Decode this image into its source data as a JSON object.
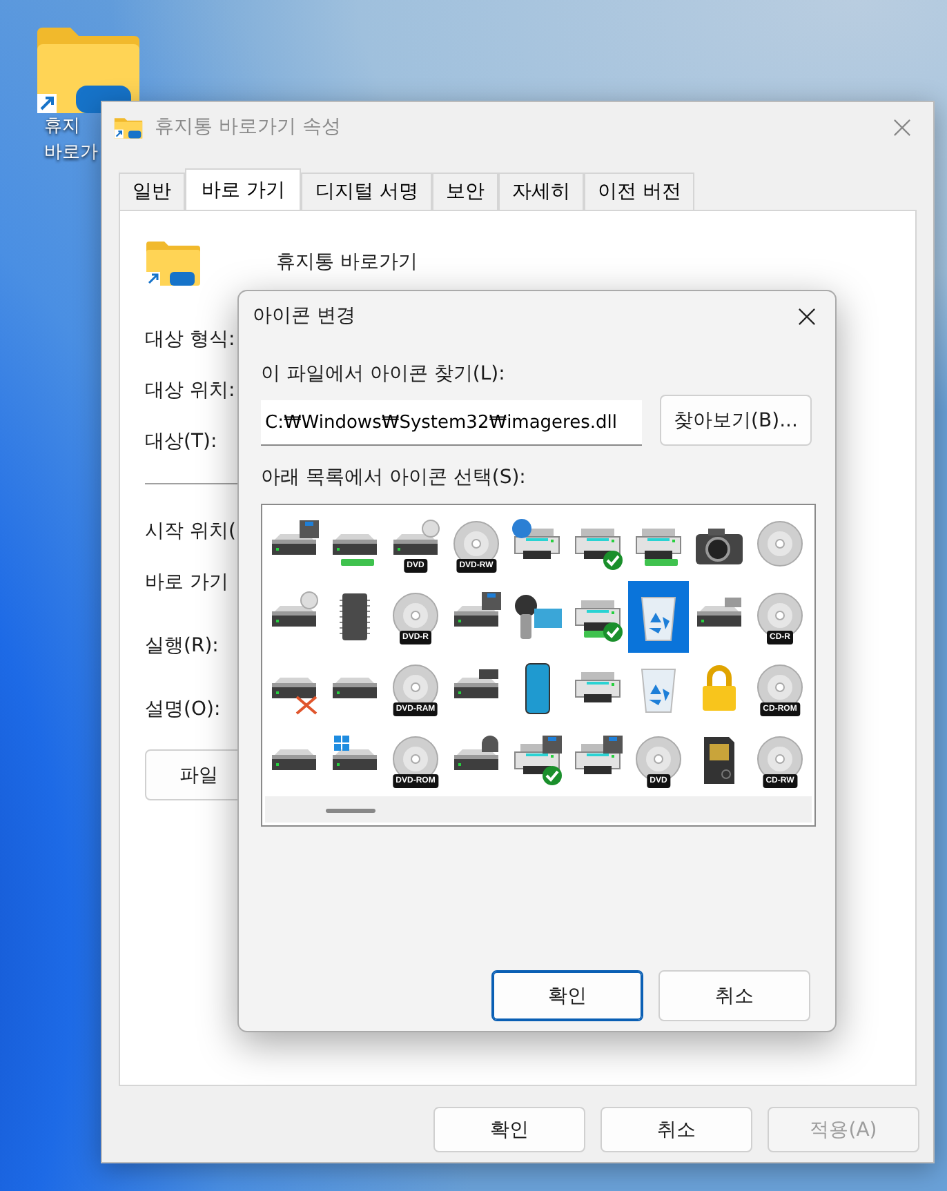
{
  "desktop_icon": {
    "label_lines": [
      "휴지",
      "바로가"
    ]
  },
  "properties_window": {
    "title": "휴지통 바로가기 속성",
    "tabs": [
      {
        "label": "일반",
        "selected": false
      },
      {
        "label": "바로 가기",
        "selected": true
      },
      {
        "label": "디지털 서명",
        "selected": false
      },
      {
        "label": "보안",
        "selected": false
      },
      {
        "label": "자세히",
        "selected": false
      },
      {
        "label": "이전 버전",
        "selected": false
      }
    ],
    "shortcut_name": "휴지통 바로가기",
    "fields": [
      {
        "kind": "label",
        "label": "대상 형식:"
      },
      {
        "kind": "label",
        "label": "대상 위치:"
      },
      {
        "kind": "label",
        "label": "대상(T):"
      },
      {
        "kind": "separator"
      },
      {
        "kind": "label",
        "label": "시작 위치("
      },
      {
        "kind": "label",
        "label": "바로 가기"
      },
      {
        "kind": "label",
        "label": "실행(R):"
      },
      {
        "kind": "label",
        "label": "설명(O):"
      }
    ],
    "open_location_button": "파일",
    "buttons": [
      {
        "label": "확인",
        "disabled": false
      },
      {
        "label": "취소",
        "disabled": false
      },
      {
        "label": "적용(A)",
        "disabled": true
      }
    ]
  },
  "change_icon_dialog": {
    "title": "아이콘 변경",
    "file_label": "이 파일에서 아이콘 찾기(L):",
    "file_path": "C:₩Windows₩System32₩imageres.dll",
    "browse_button": "찾아보기(B)...",
    "list_label": "아래 목록에서 아이콘 선택(S):",
    "icons": [
      {
        "kind": "drive-floppy",
        "selected": false
      },
      {
        "kind": "drive-usb",
        "selected": false
      },
      {
        "kind": "drive-disc",
        "badge": "DVD",
        "selected": false
      },
      {
        "kind": "disc",
        "badge": "DVD-RW",
        "selected": false
      },
      {
        "kind": "printer-globe",
        "selected": false
      },
      {
        "kind": "printer-check",
        "selected": false
      },
      {
        "kind": "printer-usb",
        "selected": false
      },
      {
        "kind": "camera",
        "selected": false
      },
      {
        "kind": "disc",
        "selected": false
      },
      {
        "kind": "drive-disc",
        "selected": false
      },
      {
        "kind": "chip",
        "selected": false
      },
      {
        "kind": "disc",
        "badge": "DVD-R",
        "selected": false
      },
      {
        "kind": "drive-floppy",
        "selected": false
      },
      {
        "kind": "camcorder",
        "selected": false
      },
      {
        "kind": "printer-usb-check",
        "selected": false
      },
      {
        "kind": "recycle",
        "selected": true
      },
      {
        "kind": "drive-card",
        "selected": false
      },
      {
        "kind": "disc",
        "badge": "CD-R",
        "selected": false
      },
      {
        "kind": "drive-x",
        "selected": false
      },
      {
        "kind": "drive",
        "selected": false
      },
      {
        "kind": "disc",
        "badge": "DVD-RAM",
        "selected": false
      },
      {
        "kind": "drive-tape",
        "selected": false
      },
      {
        "kind": "phone",
        "selected": false
      },
      {
        "kind": "printer",
        "selected": false
      },
      {
        "kind": "recycle",
        "selected": false
      },
      {
        "kind": "lock",
        "selected": false
      },
      {
        "kind": "disc",
        "badge": "CD-ROM",
        "selected": false
      },
      {
        "kind": "drive",
        "selected": false
      },
      {
        "kind": "drive-windows",
        "selected": false
      },
      {
        "kind": "disc",
        "badge": "DVD-ROM",
        "selected": false
      },
      {
        "kind": "drive-scanner",
        "selected": false
      },
      {
        "kind": "printer-floppy-check",
        "selected": false
      },
      {
        "kind": "printer-floppy",
        "selected": false
      },
      {
        "kind": "disc",
        "badge": "DVD",
        "selected": false
      },
      {
        "kind": "card",
        "selected": false
      },
      {
        "kind": "disc",
        "badge": "CD-RW",
        "selected": false
      }
    ],
    "buttons": [
      {
        "label": "확인",
        "default": true
      },
      {
        "label": "취소",
        "default": false
      }
    ]
  }
}
